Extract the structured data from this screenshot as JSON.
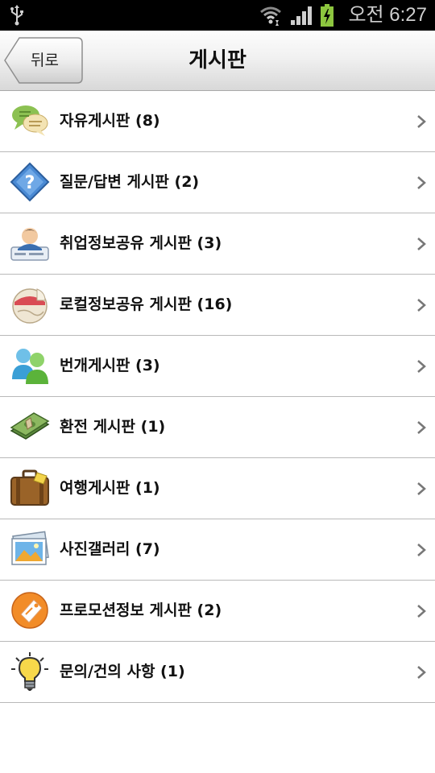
{
  "status_bar": {
    "time": "오전 6:27",
    "icons": [
      "usb-icon",
      "wifi-icon",
      "signal-icon",
      "battery-charging-icon"
    ]
  },
  "header": {
    "back_label": "뒤로",
    "title": "게시판"
  },
  "boards": [
    {
      "label": "자유게시판 (8)",
      "icon": "chat-bubbles-icon"
    },
    {
      "label": "질문/답변 게시판 (2)",
      "icon": "question-diamond-icon"
    },
    {
      "label": "취업정보공유 게시판 (3)",
      "icon": "job-person-icon"
    },
    {
      "label": "로컬정보공유 게시판 (16)",
      "icon": "local-map-sticker-icon"
    },
    {
      "label": "번개게시판 (3)",
      "icon": "people-group-icon"
    },
    {
      "label": "환전 게시판 (1)",
      "icon": "money-icon"
    },
    {
      "label": "여행게시판 (1)",
      "icon": "suitcase-icon"
    },
    {
      "label": "사진갤러리 (7)",
      "icon": "photo-gallery-icon"
    },
    {
      "label": "프로모션정보 게시판 (2)",
      "icon": "promotion-tag-icon"
    },
    {
      "label": "문의/건의 사항 (1)",
      "icon": "lightbulb-icon"
    }
  ],
  "colors": {
    "status_bar_bg": "#000000",
    "battery_green": "#8dc63f",
    "divider": "#b9b9b9"
  }
}
